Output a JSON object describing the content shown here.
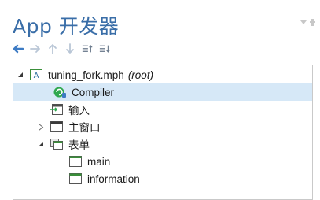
{
  "panel": {
    "title": "App 开发器"
  },
  "toolbar": {
    "buttons": [
      "back-arrow-icon",
      "forward-arrow-icon",
      "move-up-icon",
      "move-down-icon",
      "collapse-all-icon",
      "expand-all-icon"
    ]
  },
  "tree": {
    "root": {
      "name": "tuning_fork.mph",
      "suffix": "(root)",
      "expanded": true
    },
    "compiler": {
      "label": "Compiler",
      "selected": true
    },
    "input": {
      "label": "输入"
    },
    "main_window": {
      "label": "主窗口",
      "expanded": false
    },
    "forms": {
      "label": "表单",
      "expanded": true,
      "children": [
        "main",
        "information"
      ]
    }
  },
  "colors": {
    "title": "#3a6ea8",
    "selection": "#d6e8f7",
    "toolbar_arrow": "#3d7bc4",
    "tree_border": "#c9c9c9"
  }
}
